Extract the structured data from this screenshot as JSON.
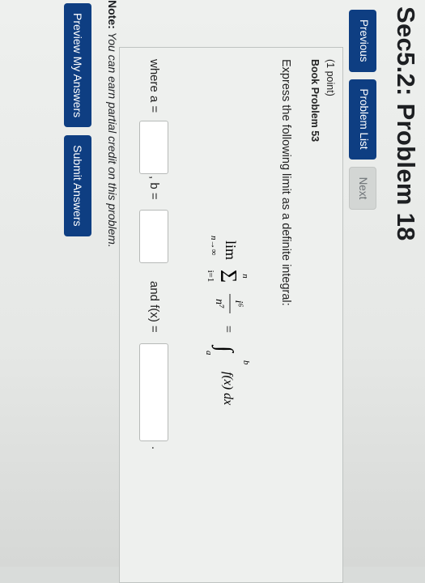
{
  "page": {
    "title": "Sec5.2: Problem 18"
  },
  "nav": {
    "previous": "Previous",
    "problem_list": "Problem List",
    "next": "Next"
  },
  "problem": {
    "points": "(1 point)",
    "book": "Book Problem 53",
    "prompt": "Express the following limit as a definite integral:",
    "formula": {
      "lim": "lim",
      "sub": "n→∞",
      "sum_top": "n",
      "sum_bottom": "i=1",
      "num": "i⁶",
      "den": "n⁷",
      "equals": "=",
      "upper": "b",
      "lower": "a",
      "integrand": "f(x) dx"
    },
    "where_a": "where a =",
    "comma_b": ", b =",
    "and_f": "and f(x) =",
    "period": "."
  },
  "inputs": {
    "a_value": "",
    "b_value": "",
    "f_value": ""
  },
  "note": {
    "label": "Note:",
    "text": "You can earn partial credit on this problem."
  },
  "actions": {
    "preview": "Preview My Answers",
    "submit": "Submit Answers"
  }
}
